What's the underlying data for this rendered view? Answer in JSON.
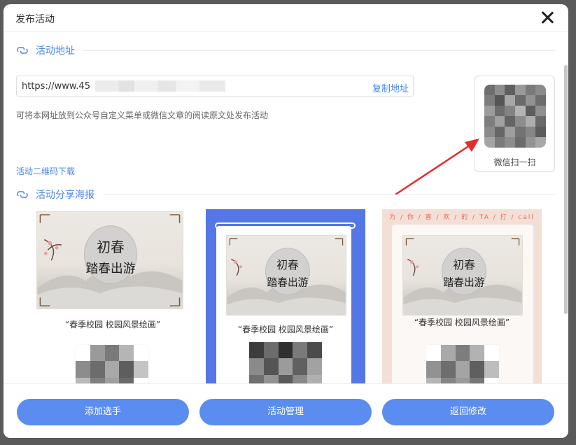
{
  "modal": {
    "title": "发布活动"
  },
  "sections": {
    "address_title": "活动地址",
    "poster_title": "活动分享海报"
  },
  "address": {
    "url_visible": "https://www.45",
    "copy_label": "复制地址",
    "hint": "可将本网址放到公众号自定义菜单或微信文章的阅读原文处发布活动",
    "qr_download": "活动二维码下载",
    "qr_caption": "微信扫一扫"
  },
  "posters": [
    {
      "caption": "“春季校园 校园风景绘画”",
      "calligraphy_1": "初春",
      "calligraphy_2": "踏春出游"
    },
    {
      "caption": "“春季校园 校园风景绘画”",
      "calligraphy_1": "初春",
      "calligraphy_2": "踏春出游"
    },
    {
      "caption": "“春季校园 校园风景绘画”",
      "top_text": "为 / 你 / 喜 / 欢 / 的 / TA / 打 / call",
      "calligraphy_1": "初春",
      "calligraphy_2": "踏春出游"
    }
  ],
  "footer": {
    "add_label": "添加选手",
    "manage_label": "活动管理",
    "back_label": "返回修改"
  },
  "colors": {
    "accent": "#4a86e8",
    "button": "#5b8df0",
    "poster2_bg": "#5576e6",
    "poster3_bg": "#f4dfd7"
  }
}
